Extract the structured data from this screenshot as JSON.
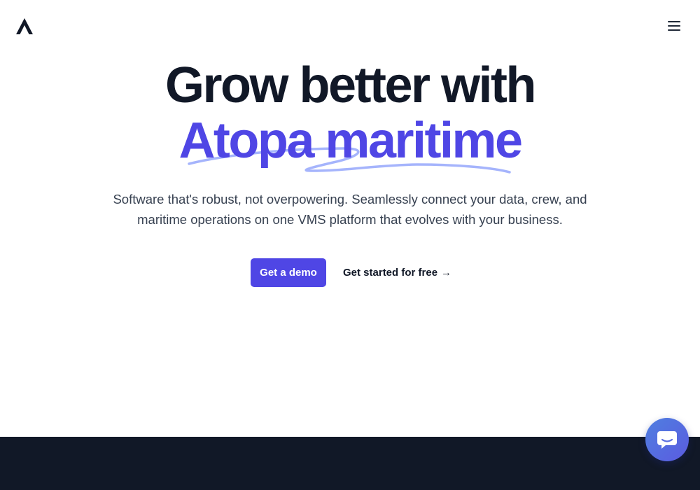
{
  "header": {
    "logo_icon": "atopa-chevron-logo-icon",
    "menu_icon": "hamburger-menu-icon"
  },
  "hero": {
    "headline_line1": "Grow better with",
    "headline_line2": "Atopa maritime",
    "subtext_line1": "Software that's robust, not overpowering. Seamlessly connect your data, crew, and",
    "subtext_line2": "maritime operations on one VMS platform that evolves with your business.",
    "primary_cta_label": "Get a demo",
    "secondary_cta_label": "Get started for free",
    "secondary_cta_arrow": "→"
  },
  "chat_widget": {
    "icon": "chat-bubble-icon"
  },
  "colors": {
    "accent": "#4f46e5",
    "heading": "#111827",
    "body_text": "#374151",
    "underline_stroke": "#a5b4fc",
    "footer_band": "#111827"
  }
}
